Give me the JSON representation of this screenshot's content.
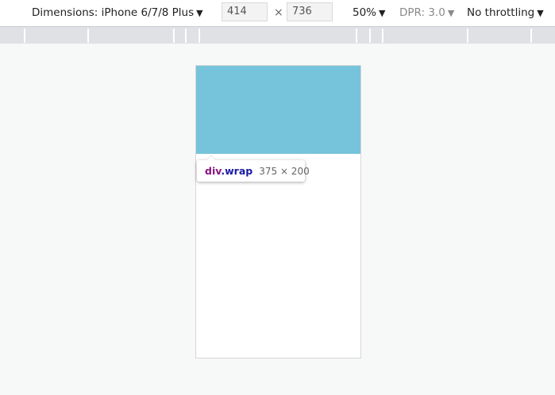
{
  "toolbar": {
    "dimensions_label": "Dimensions: iPhone 6/7/8 Plus",
    "width_value": "414",
    "times_symbol": "×",
    "height_value": "736",
    "zoom_label": "50%",
    "dpr_label": "DPR: 3.0",
    "throttling_label": "No throttling",
    "dropdown_arrow": "▼"
  },
  "inspector_tooltip": {
    "tag": "div",
    "class_name": ".wrap",
    "size": "375 × 200"
  },
  "colors": {
    "highlight": "#76c4db",
    "tag": "#881280",
    "class": "#1a1aa6"
  }
}
